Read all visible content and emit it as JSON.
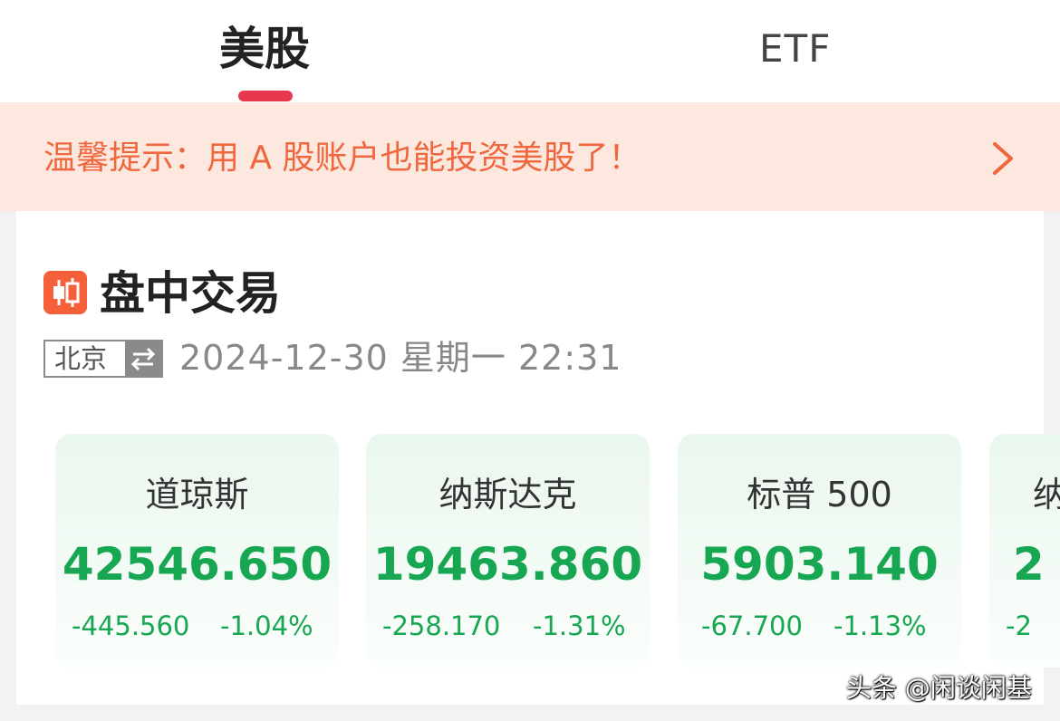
{
  "tabs": [
    {
      "label": "美股",
      "selected": true
    },
    {
      "label": "ETF",
      "selected": false
    }
  ],
  "banner": {
    "text": "温馨提示：用 A 股账户也能投资美股了！"
  },
  "section": {
    "title": "盘中交易"
  },
  "timezone": {
    "label": "北京"
  },
  "datetime": "2024-12-30 星期一  22:31",
  "indices": [
    {
      "name": "道琼斯",
      "value": "42546.650",
      "change": "-445.560",
      "pct": "-1.04%"
    },
    {
      "name": "纳斯达克",
      "value": "19463.860",
      "change": "-258.170",
      "pct": "-1.31%"
    },
    {
      "name": "标普 500",
      "value": "5903.140",
      "change": "-67.700",
      "pct": "-1.13%"
    },
    {
      "name": "纳",
      "value": "2",
      "change": "-2"
    }
  ],
  "colors": {
    "accent": "#e8384f",
    "banner_text": "#f0673d",
    "down_green": "#17a651"
  },
  "watermark": "头条 @闲谈闲基"
}
